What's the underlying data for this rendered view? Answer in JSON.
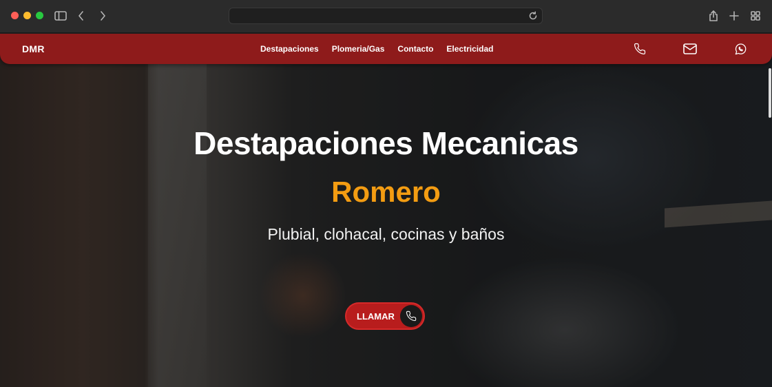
{
  "browser": {
    "url": "",
    "icons": [
      "sidebar-icon",
      "back-icon",
      "forward-icon",
      "reload-icon",
      "share-icon",
      "new-tab-icon",
      "tab-overview-icon"
    ]
  },
  "site": {
    "brand": "DMR",
    "menu": [
      {
        "label": "Destapaciones"
      },
      {
        "label": "Plomeria/Gas"
      },
      {
        "label": "Contacto"
      },
      {
        "label": "Electricidad"
      }
    ],
    "contact_icons": [
      "phone-icon",
      "mail-icon",
      "whatsapp-icon"
    ]
  },
  "hero": {
    "title": "Destapaciones Mecanicas",
    "subtitle": "Romero",
    "tagline": "Plubial, clohacal, cocinas y baños",
    "cta_label": "LLAMAR"
  },
  "colors": {
    "nav_bg": "#8e1b1b",
    "accent": "#f39c12",
    "cta_bg": "#b81d1d"
  }
}
